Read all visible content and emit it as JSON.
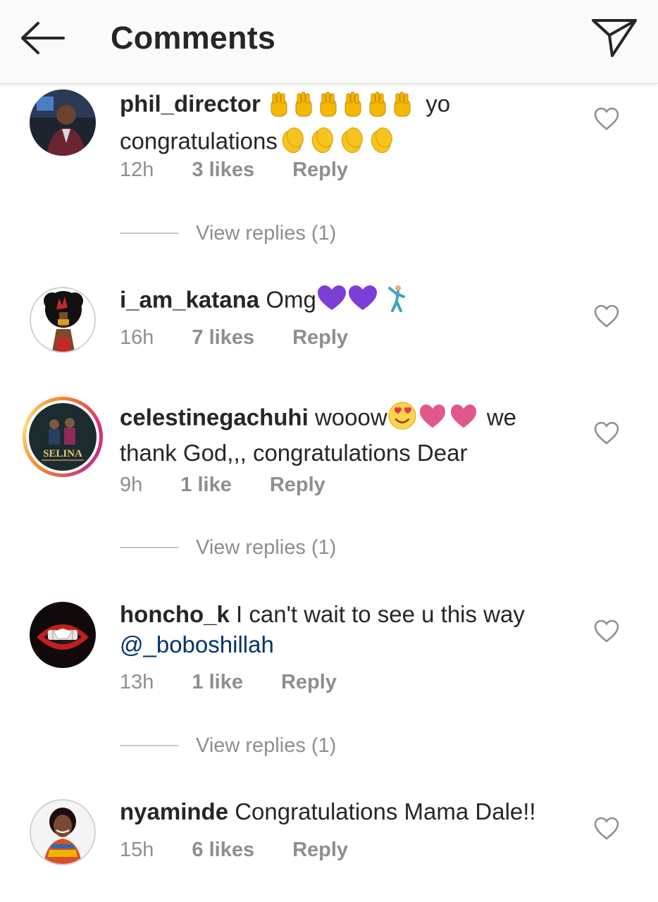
{
  "header": {
    "title": "Comments",
    "back_icon": "arrow-left-icon",
    "send_icon": "paper-plane-icon"
  },
  "comments": [
    {
      "username": "phil_director",
      "text_1": "yo",
      "text_2": "congratulations",
      "emojis": [
        "raised-hands",
        "clapping-hands"
      ],
      "time": "12h",
      "likes": "3 likes",
      "reply": "Reply",
      "view_replies": "View replies (1)"
    },
    {
      "username": "i_am_katana",
      "text": "Omg",
      "emojis": [
        "purple-heart",
        "person-dancing"
      ],
      "time": "16h",
      "likes": "7 likes",
      "reply": "Reply"
    },
    {
      "username": "celestinegachuhi",
      "text_1": "wooow",
      "text_2": "we",
      "text_3": "thank God,,, congratulations Dear",
      "avatar_label": "SELINA",
      "emojis": [
        "heart-eyes",
        "pink-heart"
      ],
      "time": "9h",
      "likes": "1 like",
      "reply": "Reply",
      "view_replies": "View replies (1)"
    },
    {
      "username": "honcho_k",
      "text": "I can't wait to see u this way",
      "mention": "@_boboshillah",
      "time": "13h",
      "likes": "1 like",
      "reply": "Reply",
      "view_replies": "View replies (1)"
    },
    {
      "username": "nyaminde",
      "text": "Congratulations Mama Dale!!",
      "time": "15h",
      "likes": "6 likes",
      "reply": "Reply"
    }
  ],
  "colors": {
    "text": "#262626",
    "secondary": "#8e8e8e",
    "mention": "#003569",
    "header_bg": "#fafafa"
  }
}
